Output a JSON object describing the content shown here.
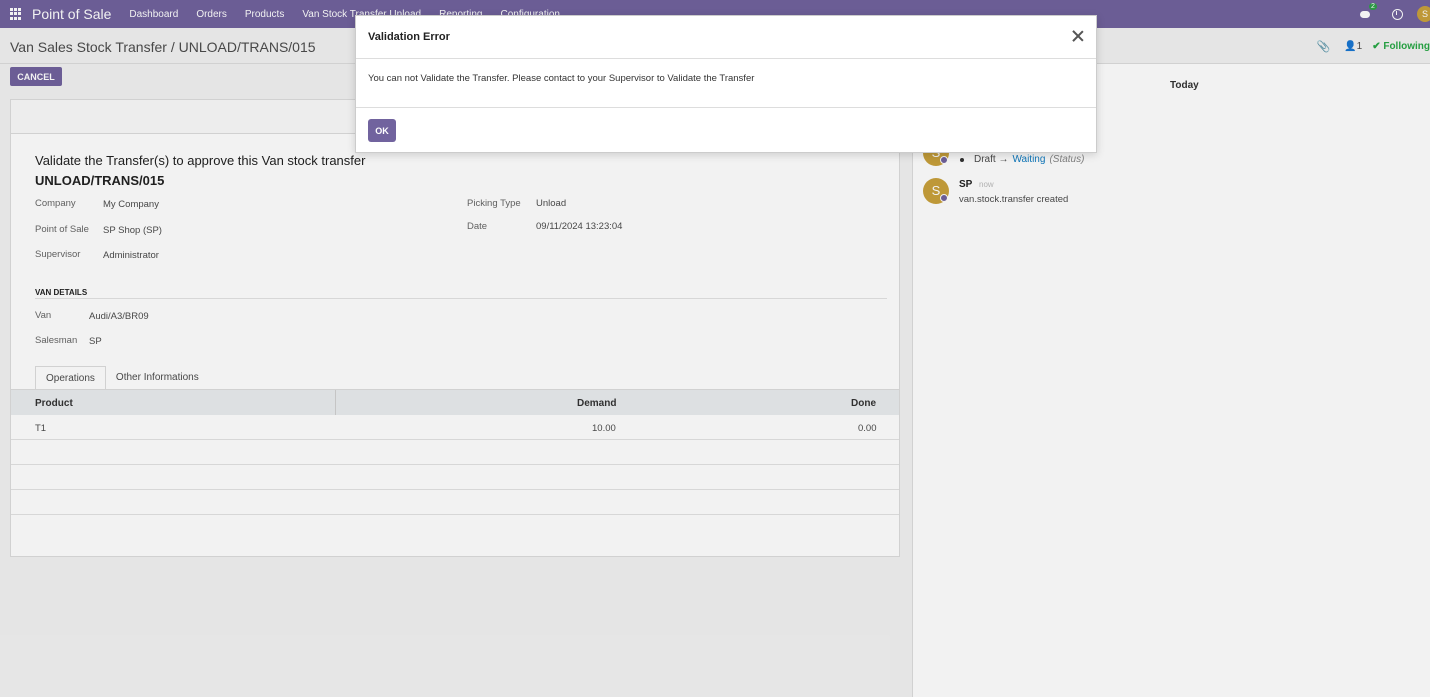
{
  "navbar": {
    "brand": "Point of Sale",
    "menu": [
      "Dashboard",
      "Orders",
      "Products",
      "Van Stock Transfer Unload",
      "Reporting",
      "Configuration"
    ],
    "message_count": "2",
    "user_initial": "S"
  },
  "control_panel": {
    "breadcrumb": "Van Sales Stock Transfer / UNLOAD/TRANS/015",
    "cancel_label": "CANCEL",
    "followers_count": "1",
    "following_label": "✔ Following"
  },
  "form": {
    "title": "Validate the Transfer(s) to approve this Van stock transfer",
    "reference": "UNLOAD/TRANS/015",
    "fields": {
      "company_label": "Company",
      "company_value": "My Company",
      "pos_label": "Point of Sale",
      "pos_value": "SP Shop (SP)",
      "supervisor_label": "Supervisor",
      "supervisor_value": "Administrator",
      "picking_type_label": "Picking Type",
      "picking_type_value": "Unload",
      "date_label": "Date",
      "date_value": "09/11/2024 13:23:04"
    },
    "van_section": {
      "title": "VAN DETAILS",
      "van_label": "Van",
      "van_value": "Audi/A3/BR09",
      "salesman_label": "Salesman",
      "salesman_value": "SP"
    },
    "tabs": [
      "Operations",
      "Other Informations"
    ],
    "table": {
      "headers": [
        "Product",
        "Demand",
        "Done"
      ],
      "rows": [
        {
          "product": "T1",
          "demand": "10.00",
          "done": "0.00"
        }
      ]
    }
  },
  "chatter": {
    "date_label": "Today",
    "tracking": {
      "old": "Draft",
      "arrow": "→",
      "new": "Waiting",
      "field": "(Status)"
    },
    "message": {
      "author": "SP",
      "avatar_initial": "S",
      "time": "now",
      "body": "van.stock.transfer created"
    }
  },
  "modal": {
    "title": "Validation Error",
    "body": "You can not Validate the Transfer. Please contact to your Supervisor to Validate the Transfer",
    "ok_label": "OK"
  },
  "colors": {
    "brand": "#71639e",
    "avatar": "#c9a13c",
    "following": "#28a745",
    "link": "#0f7cc2"
  }
}
